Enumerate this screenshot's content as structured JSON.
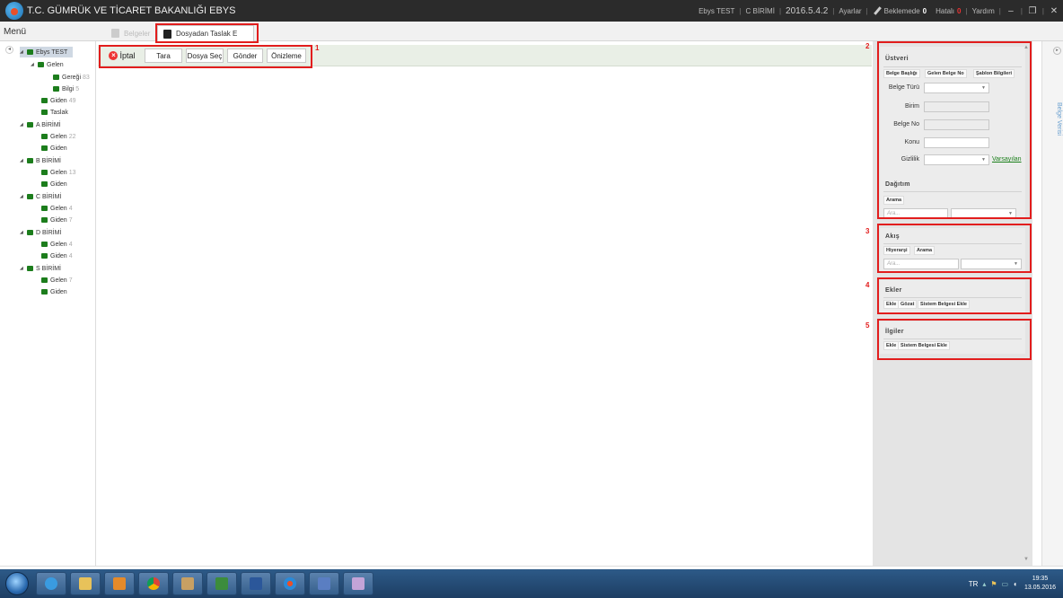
{
  "titlebar": {
    "title": "T.C. GÜMRÜK VE TİCARET BAKANLIĞI EBYS",
    "user": "Ebys TEST",
    "unit": "C BİRİMİ",
    "version": "2016.5.4.2",
    "settings": "Ayarlar",
    "pending_label": "Beklemede",
    "pending_count": "0",
    "errors_label": "Hatalı",
    "errors_count": "0",
    "help": "Yardım"
  },
  "menu": {
    "label": "Menü",
    "tabs": [
      {
        "label": "Belgeler"
      },
      {
        "label": "Dosyadan Taslak E"
      }
    ]
  },
  "tree": [
    {
      "label": "Ebys TEST",
      "count": ""
    },
    {
      "label": "Gelen",
      "count": ""
    },
    {
      "label": "Gereği",
      "count": "83"
    },
    {
      "label": "Bilgi",
      "count": "5"
    },
    {
      "label": "Giden",
      "count": "49"
    },
    {
      "label": "Taslak",
      "count": ""
    },
    {
      "label": "A BİRİMİ",
      "count": ""
    },
    {
      "label": "Gelen",
      "count": "22"
    },
    {
      "label": "Giden",
      "count": ""
    },
    {
      "label": "B BİRİMİ",
      "count": ""
    },
    {
      "label": "Gelen",
      "count": "13"
    },
    {
      "label": "Giden",
      "count": ""
    },
    {
      "label": "C BİRİMİ",
      "count": ""
    },
    {
      "label": "Gelen",
      "count": "4"
    },
    {
      "label": "Giden",
      "count": "7"
    },
    {
      "label": "D BİRİMİ",
      "count": ""
    },
    {
      "label": "Gelen",
      "count": "4"
    },
    {
      "label": "Giden",
      "count": "4"
    },
    {
      "label": "S BİRİMİ",
      "count": ""
    },
    {
      "label": "Gelen",
      "count": "7"
    },
    {
      "label": "Giden",
      "count": ""
    }
  ],
  "toolbar": {
    "cancel": "İptal",
    "scan": "Tara",
    "choose_file": "Dosya Seç",
    "send": "Gönder",
    "preview": "Önizleme"
  },
  "annotations": [
    "1",
    "2",
    "3",
    "4",
    "5"
  ],
  "ustveri": {
    "title": "Üstveri",
    "tabs": [
      "Belge Başlığı",
      "Gelen Belge No",
      "Şablon Bilgileri"
    ],
    "fields": {
      "belge_turu": "Belge Türü",
      "birim": "Birim",
      "belge_no": "Belge No",
      "konu": "Konu",
      "gizlilik": "Gizlilik"
    },
    "default_link": "Varsayılan"
  },
  "dagitim": {
    "title": "Dağıtım",
    "tab": "Arama",
    "search_placeholder": "Ara..."
  },
  "akis": {
    "title": "Akış",
    "tabs": [
      "Hiyerarşi",
      "Arama"
    ],
    "search_placeholder": "Ara..."
  },
  "ekler": {
    "title": "Ekler",
    "buttons": [
      "Ekle",
      "Gözat",
      "Sistem Belgesi Ekle"
    ]
  },
  "ilgiler": {
    "title": "İlgiler",
    "buttons": [
      "Ekle",
      "Sistem Belgesi Ekle"
    ]
  },
  "side_rail": {
    "label": "Belge Verisi"
  },
  "taskbar": {
    "lang": "TR",
    "time": "19:35",
    "date": "13.05.2016"
  }
}
